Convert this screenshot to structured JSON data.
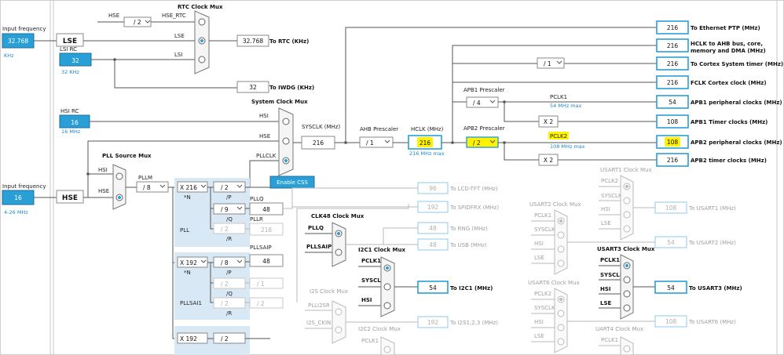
{
  "colors": {
    "accent": "#2a9fd6",
    "highlight": "#fff200",
    "source": "#2a9fd6"
  },
  "left": {
    "input_freq_label": "Input frequency",
    "lse_value": "32.768",
    "lse_unit": "KHz",
    "lse_label": "LSE",
    "lsi_rc_label": "LSI RC",
    "lsi_value": "32",
    "lsi_unit": "32 KHz",
    "hsi_rc_label": "HSI RC",
    "hsi_value": "16",
    "hsi_unit": "16 MHz",
    "hse_input_label": "Input frequency",
    "hse_value": "16",
    "hse_label": "HSE",
    "hse_range": "4-26 MHz"
  },
  "rtc": {
    "title": "RTC Clock Mux",
    "hse_label": "HSE",
    "div": "/ 2",
    "hse_rtc": "HSE_RTC",
    "lse": "LSE",
    "lsi": "LSI",
    "value": "32.768",
    "out_label": "To RTC (KHz)"
  },
  "iwdg": {
    "value": "32",
    "label": "To IWDG (KHz)"
  },
  "sysmux": {
    "title": "System Clock Mux",
    "hsi": "HSI",
    "hse": "HSE",
    "pllclk": "PLLCLK",
    "enable_css": "Enable CSS"
  },
  "sysclk": {
    "label": "SYSCLK (MHz)",
    "value": "216"
  },
  "ahb": {
    "label": "AHB Prescaler",
    "value": "/ 1"
  },
  "hclk": {
    "label": "HCLK (MHz)",
    "value": "216",
    "max": "216 MHz max"
  },
  "apb1": {
    "label": "APB1 Prescaler",
    "value": "/ 4",
    "pclk": "PCLK1",
    "max": "54 MHz max",
    "x2": "X 2"
  },
  "apb2": {
    "label": "APB2 Prescaler",
    "value": "/ 2",
    "pclk": "PCLK2",
    "max": "108 MHz max",
    "x2": "X 2"
  },
  "cortex_div": "/ 1",
  "outputs": [
    {
      "value": "216",
      "label": "To Ethernet PTP (MHz)"
    },
    {
      "value": "216",
      "label": "HCLK to AHB bus, core,",
      "label2": "memory and DMA (MHz)"
    },
    {
      "value": "216",
      "label": "To Cortex System timer (MHz)"
    },
    {
      "value": "216",
      "label": "FCLK Cortex clock (MHz)"
    },
    {
      "value": "54",
      "label": "APB1 peripheral clocks (MHz)"
    },
    {
      "value": "108",
      "label": "APB1 Timer clocks (MHz)"
    },
    {
      "value": "108",
      "label": "APB2 peripheral clocks (MHz)"
    },
    {
      "value": "216",
      "label": "APB2 timer clocks (MHz)"
    }
  ],
  "pll": {
    "src_mux_title": "PLL Source Mux",
    "hsi": "HSI",
    "hse": "HSE",
    "pllm_label": "PLLM",
    "pllm": "/ 8",
    "n": "X 216",
    "n_label": "*N",
    "p": "/ 2",
    "p_label": "/P",
    "q": "/ 9",
    "q_label": "/Q",
    "r": "/ 2",
    "r_label": "/R",
    "pllq_label": "PLLQ",
    "pllq": "48",
    "pllr_label": "PLLR",
    "pllr": "216",
    "pll_label": "PLL"
  },
  "pllsai": {
    "n": "X 192",
    "n_label": "*N",
    "p": "/ 8",
    "p_label": "/P",
    "q": "/ 2",
    "q_label": "/Q",
    "q2": "/ 1",
    "r": "/ 2",
    "r_label": "/R",
    "r2": "/ 2",
    "pllsaip_label": "PLLSAIP",
    "pllsaip": "48",
    "label": "PLLSAI1"
  },
  "plli2s": {
    "n": "X 192",
    "p": "/ 2"
  },
  "mid_outputs": [
    {
      "value": "96",
      "label": "To LCD-TFT (MHz)"
    },
    {
      "value": "192",
      "label": "To SPIDFRX (MHz)"
    },
    {
      "value": "48",
      "label": "To RNG (MHz)"
    },
    {
      "value": "48",
      "label": "To USB (MHz)"
    }
  ],
  "clk48": {
    "title": "CLK48 Clock Mux",
    "pllq": "PLLQ",
    "pllsaip": "PLLSAIP"
  },
  "i2c1": {
    "title": "I2C1 Clock Mux",
    "pclk1": "PCLK1",
    "sysclk": "SYSCLK",
    "hsi": "HSI",
    "value": "54",
    "label": "To I2C1 (MHz)"
  },
  "i2s": {
    "title": "I2S Clock Mux",
    "plli2sr": "PLLI2SR",
    "ckin": "I2S_CKIN"
  },
  "i2c2": {
    "title": "I2C2 Clock Mux",
    "pclk1": "PCLK1",
    "value": "192",
    "label": "To I2S1,2,3 (MHz)"
  },
  "usart1": {
    "title": "USART1 Clock Mux",
    "in1": "PCLK2",
    "in2": "SYSCLK",
    "in3": "HSI",
    "in4": "LSE",
    "value": "108",
    "label": "To USART1 (MHz)"
  },
  "usart2": {
    "title": "USART2 Clock Mux",
    "in1": "PCLK1",
    "in2": "SYSCLK",
    "in3": "HSI",
    "in4": "LSE",
    "value": "54",
    "label": "To USART2 (MHz)"
  },
  "usart3": {
    "title": "USART3 Clock Mux",
    "in1": "PCLK1",
    "in2": "SYSCLK",
    "in3": "HSI",
    "in4": "LSE",
    "value": "54",
    "label": "To USART3 (MHz)"
  },
  "usart6": {
    "title": "USART6 Clock Mux",
    "in1": "PCLK2",
    "in2": "SYSCLK",
    "in3": "HSI",
    "in4": "LSE",
    "value": "108",
    "label": "To USART6 (MHz)"
  },
  "uart4": {
    "title": "UART4 Clock Mux",
    "in1": "PCLK1"
  }
}
